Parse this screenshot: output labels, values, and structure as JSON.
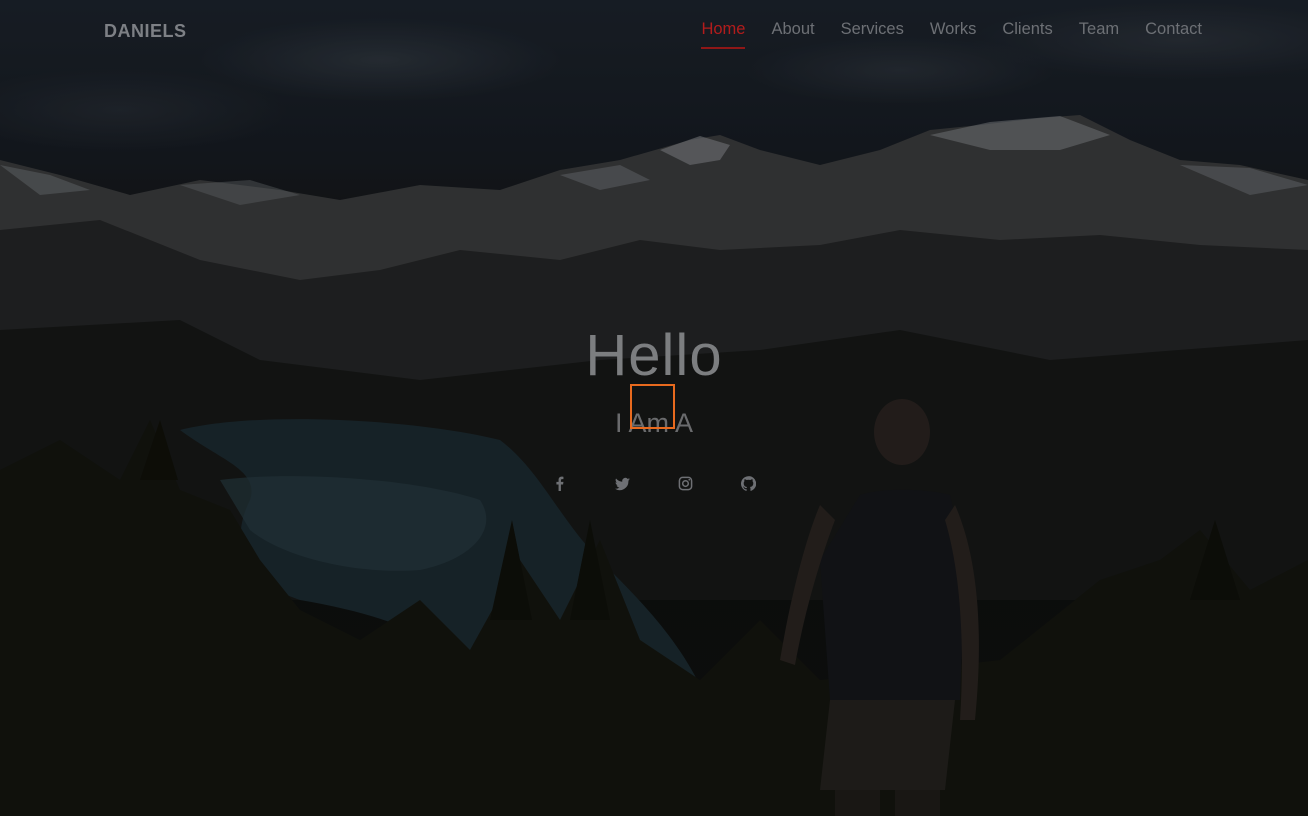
{
  "navbar": {
    "brand": "DANIELS",
    "links": [
      {
        "label": "Home",
        "active": true
      },
      {
        "label": "About"
      },
      {
        "label": "Services"
      },
      {
        "label": "Works"
      },
      {
        "label": "Clients"
      },
      {
        "label": "Team"
      },
      {
        "label": "Contact"
      }
    ]
  },
  "hero": {
    "heading": "Hello",
    "subtitle": "I Am A"
  },
  "social": {
    "icons": [
      "facebook-icon",
      "twitter-icon",
      "instagram-icon",
      "github-icon"
    ]
  },
  "colors": {
    "accent": "#b21c1c",
    "cursor_highlight": "#e86a1e"
  }
}
